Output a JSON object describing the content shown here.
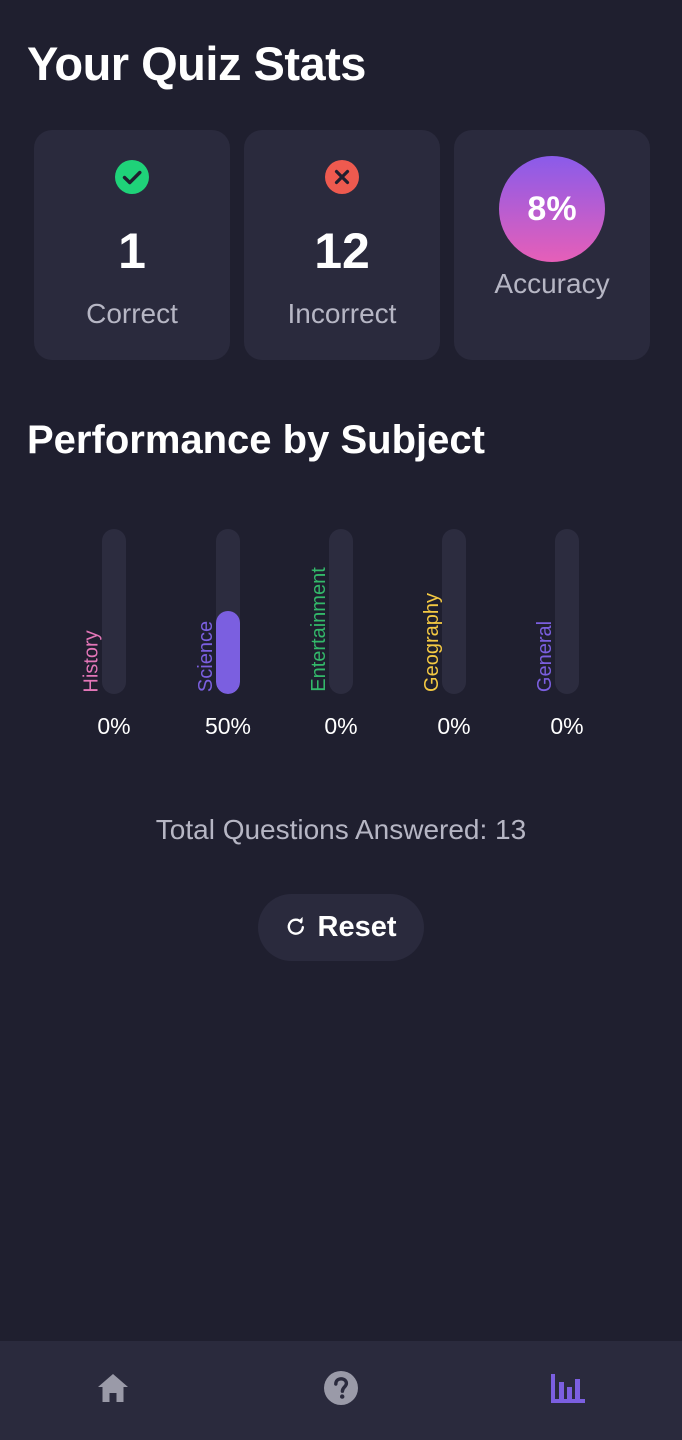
{
  "page": {
    "title": "Your Quiz Stats"
  },
  "stats": {
    "correct": {
      "value": "1",
      "label": "Correct",
      "icon": "check-circle-icon",
      "color": "#1fd279"
    },
    "incorrect": {
      "value": "12",
      "label": "Incorrect",
      "icon": "x-circle-icon",
      "color": "#ee5a4f"
    },
    "accuracy": {
      "value": "8%",
      "label": "Accuracy",
      "gradient_top": "#8a5bea",
      "gradient_bottom": "#e65fb8"
    }
  },
  "performance": {
    "title": "Performance by Subject",
    "subjects": [
      {
        "name": "History",
        "percent_label": "0%",
        "fill": 0,
        "color": "#e376b8"
      },
      {
        "name": "Science",
        "percent_label": "50%",
        "fill": 0.5,
        "color": "#7b5fe0"
      },
      {
        "name": "Entertainment",
        "percent_label": "0%",
        "fill": 0,
        "color": "#33b86a"
      },
      {
        "name": "Geography",
        "percent_label": "0%",
        "fill": 0,
        "color": "#f4c943"
      },
      {
        "name": "General",
        "percent_label": "0%",
        "fill": 0,
        "color": "#7b5fe0"
      }
    ]
  },
  "total": {
    "text": "Total Questions Answered: 13"
  },
  "reset": {
    "label": "Reset",
    "icon": "refresh-icon"
  },
  "nav": {
    "items": [
      {
        "name": "home-icon",
        "active": false
      },
      {
        "name": "help-icon",
        "active": false
      },
      {
        "name": "bar-chart-icon",
        "active": true
      }
    ],
    "active_color": "#7b5fe0",
    "inactive_color": "#9a9aa8"
  }
}
